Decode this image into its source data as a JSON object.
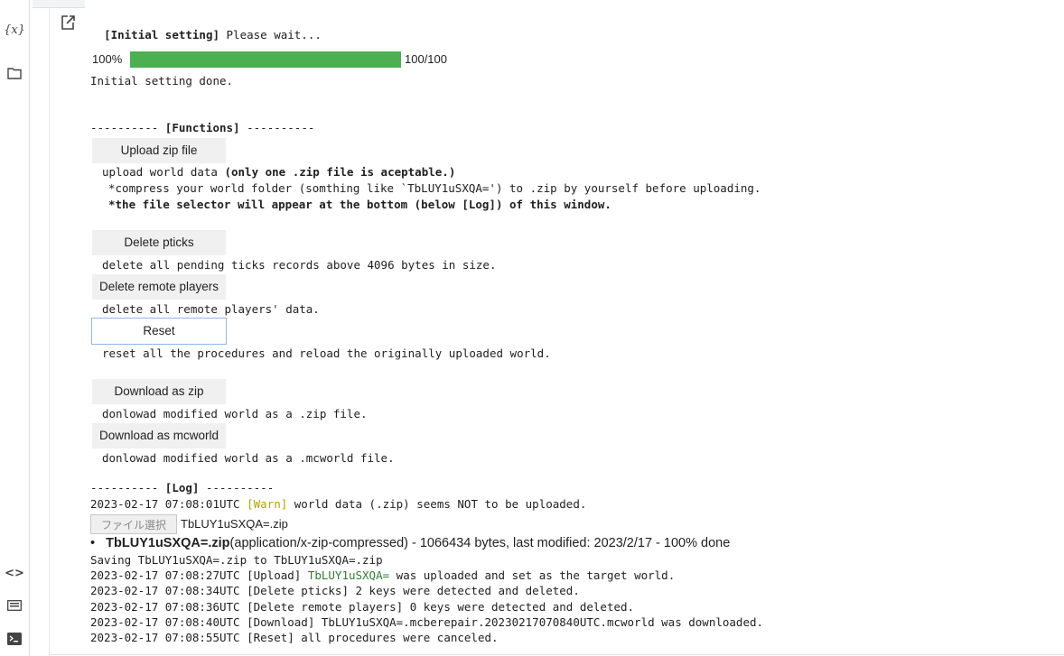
{
  "sidebar": {
    "variables_icon": "{x}",
    "folder_icon": "folder-icon",
    "code_icon": "<>",
    "keyboard_icon": "keyboard-icon",
    "terminal_icon": "terminal-icon"
  },
  "output": {
    "header_bold": "[Initial setting]",
    "header_rest": " Please wait...",
    "progress": {
      "percent_label": "100%",
      "value": 100,
      "max": 100,
      "count_label": "100/100",
      "bar_color": "#4caf50"
    },
    "initial_done": "Initial setting done.",
    "functions_prefix": "---------- ",
    "functions_title": "[Functions]",
    "functions_suffix": " ----------",
    "upload": {
      "button": "Upload zip file",
      "desc_normal": "upload world data ",
      "desc_bold": "(only one .zip file is aceptable.)",
      "note1": "*compress your world folder (somthing like `TbLUY1uSXQA=') to .zip by yourself before uploading.",
      "note2": "*the file selector will appear at the bottom (below [Log]) of this window."
    },
    "delete_pticks": {
      "button": "Delete pticks",
      "desc": "delete all pending ticks records above 4096 bytes in size."
    },
    "delete_remote": {
      "button": "Delete remote players",
      "desc": "delete all remote players' data."
    },
    "reset": {
      "button": "Reset",
      "desc": "reset all the procedures and reload the originally uploaded world."
    },
    "download_zip": {
      "button": "Download as zip",
      "desc": "donlowad modified world as a .zip file."
    },
    "download_mcworld": {
      "button": "Download as mcworld",
      "desc": "donlowad modified world as a .mcworld file."
    },
    "log_prefix": "---------- ",
    "log_title": "[Log]",
    "log_suffix": " ----------",
    "log": {
      "warn_time": "2023-02-17 07:08:01UTC ",
      "warn_tag": "[Warn]",
      "warn_msg": " world data (.zip) seems NOT to be uploaded.",
      "file_button": "ファイル選択",
      "file_name": "TbLUY1uSXQA=.zip",
      "bullet": "•",
      "upload_name": "TbLUY1uSXQA=.zip",
      "upload_info": "(application/x-zip-compressed) - 1066434 bytes, last modified: 2023/2/17 - 100% done",
      "saving": "Saving TbLUY1uSXQA=.zip to TbLUY1uSXQA=.zip",
      "upl_time": "2023-02-17 07:08:27UTC [Upload] ",
      "upl_world": "TbLUY1uSXQA=",
      "upl_rest": " was uploaded and set as the target world.",
      "line_pticks": "2023-02-17 07:08:34UTC [Delete pticks] 2 keys were detected and deleted.",
      "line_remote": "2023-02-17 07:08:36UTC [Delete remote players] 0 keys were detected and deleted.",
      "line_download": "2023-02-17 07:08:40UTC [Download] TbLUY1uSXQA=.mcberepair.20230217070840UTC.mcworld was downloaded.",
      "line_reset": "2023-02-17 07:08:55UTC [Reset] all procedures were canceled."
    }
  }
}
